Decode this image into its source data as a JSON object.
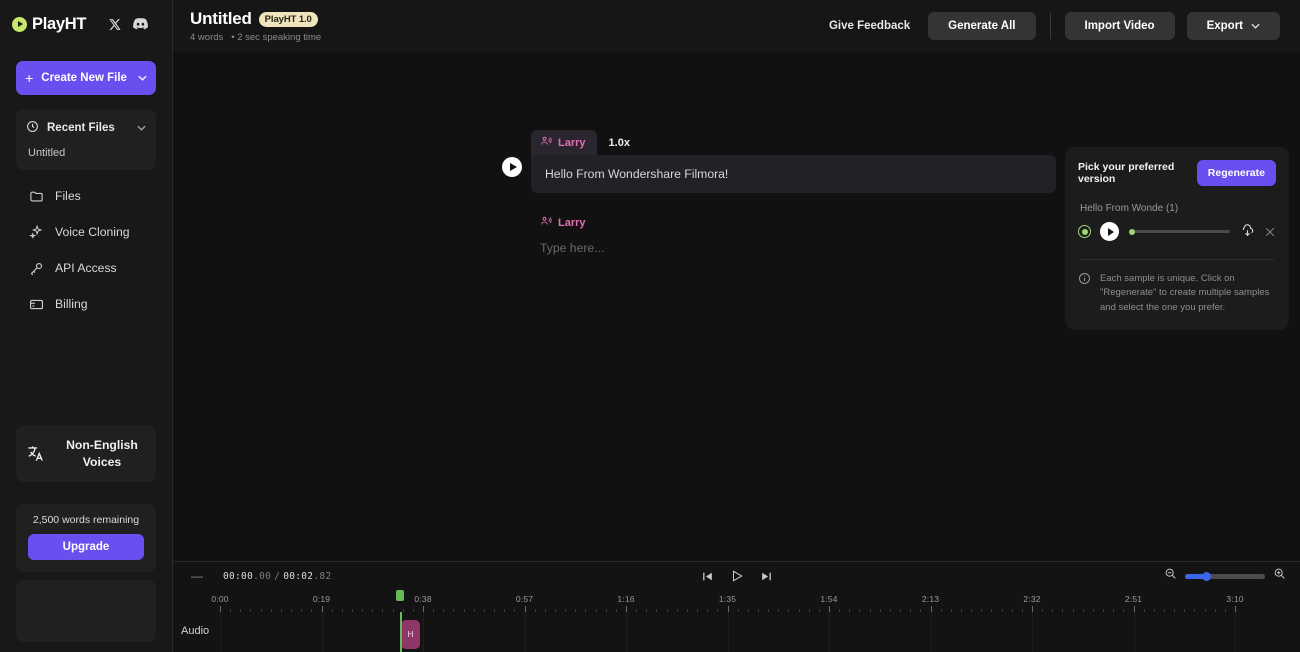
{
  "brand": {
    "name": "PlayHT",
    "logo_color": "#c6e86b",
    "social": [
      "x-icon",
      "discord-icon"
    ]
  },
  "sidebar": {
    "create_button": {
      "label": "Create New File",
      "icon": "plus-icon",
      "chevron": "chevron-down-icon",
      "color": "#6b4ef0"
    },
    "recent": {
      "label": "Recent Files",
      "icon": "clock-icon",
      "chevron": "chevron-down-icon",
      "items": [
        "Untitled"
      ]
    },
    "nav": [
      {
        "label": "Files",
        "icon": "folder-icon"
      },
      {
        "label": "Voice Cloning",
        "icon": "sparkles-icon"
      },
      {
        "label": "API Access",
        "icon": "key-icon"
      },
      {
        "label": "Billing",
        "icon": "credit-card-icon"
      }
    ],
    "non_english": {
      "label": "Non-English Voices",
      "icon": "translate-icon"
    },
    "upgrade": {
      "words_remaining": "2,500 words remaining",
      "button": "Upgrade",
      "color": "#6b4ef0"
    }
  },
  "header": {
    "title": "Untitled",
    "badge": "PlayHT 1.0",
    "badge_color": "#f0e4bc",
    "meta_words": "4 words",
    "meta_time": "• 2 sec speaking time",
    "give_feedback": "Give Feedback",
    "generate_all": "Generate All",
    "import_video": "Import Video",
    "export": "Export",
    "export_chevron": "chevron-down-icon"
  },
  "editor": {
    "play_icon": "play-icon",
    "voice_name": "Larry",
    "voice_icon": "voice-icon",
    "speed": "1.0x",
    "text": "Hello From Wondershare Filmora!",
    "voice_name_2": "Larry",
    "placeholder": "Type here..."
  },
  "version_panel": {
    "title": "Pick your preferred version",
    "regenerate": "Regenerate",
    "regenerate_color": "#6b4ef0",
    "sample_name": "Hello From Wonde (1)",
    "radio_icon": "radio-selected-icon",
    "radio_color": "#9fd477",
    "play_icon": "play-icon",
    "download_icon": "download-icon",
    "close_icon": "close-icon",
    "info_icon": "info-icon",
    "note": "Each sample is unique. Click on \"Regenerate\" to create multiple samples and select the one you prefer."
  },
  "timeline": {
    "menu_icon": "menu-icon",
    "current_time": "00:00",
    "current_ms": ".00",
    "separator": "/",
    "total_time": "00:02",
    "total_ms": ".82",
    "transport": [
      "skip-to-start-icon",
      "play-icon",
      "skip-to-end-icon"
    ],
    "zoom_out_icon": "zoom-out-icon",
    "zoom_in_icon": "zoom-in-icon",
    "zoom_slider_color": "#3b66e8",
    "zoom_value": 22,
    "ruler_ticks": [
      "0:00",
      "0:19",
      "0:38",
      "0:57",
      "1:16",
      "1:35",
      "1:54",
      "2:13",
      "2:32",
      "2:51",
      "3:10"
    ],
    "track_label": "Audio",
    "clip_label": "H",
    "clip_color": "#8e3668",
    "playhead_color": "#6aba5a"
  }
}
